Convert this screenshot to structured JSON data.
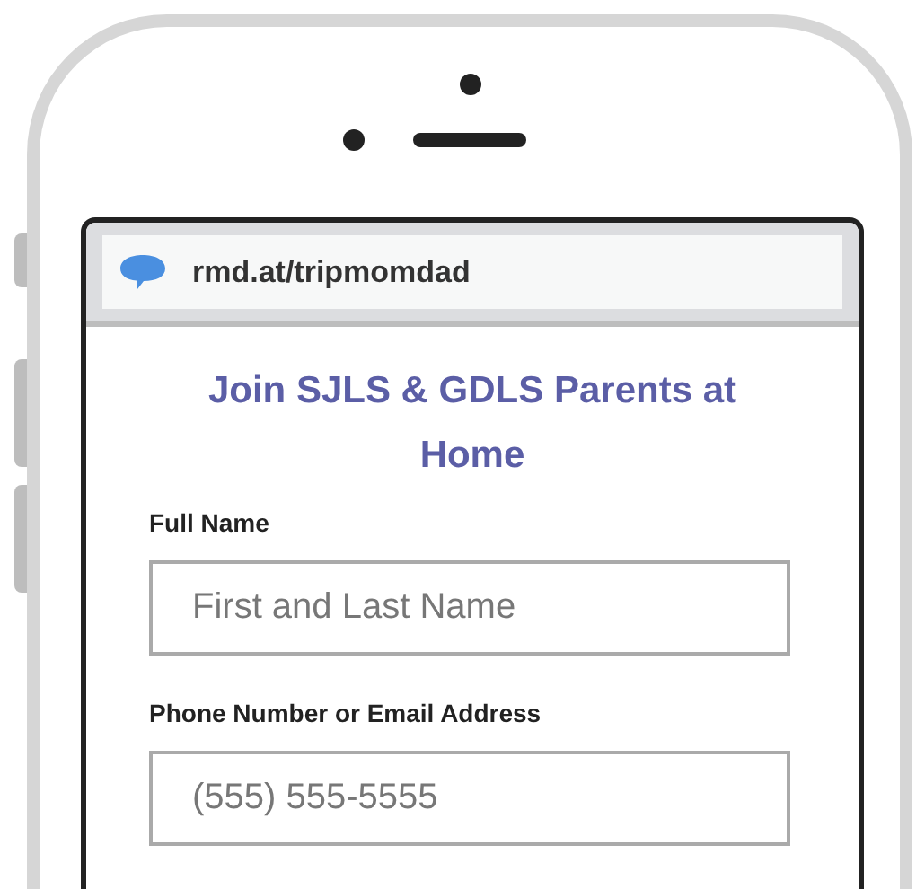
{
  "browser": {
    "url": "rmd.at/tripmomdad"
  },
  "form": {
    "title": "Join SJLS & GDLS Parents at Home",
    "fields": [
      {
        "label": "Full Name",
        "placeholder": "First and Last Name"
      },
      {
        "label": "Phone Number or Email Address",
        "placeholder": "(555) 555-5555"
      }
    ]
  }
}
